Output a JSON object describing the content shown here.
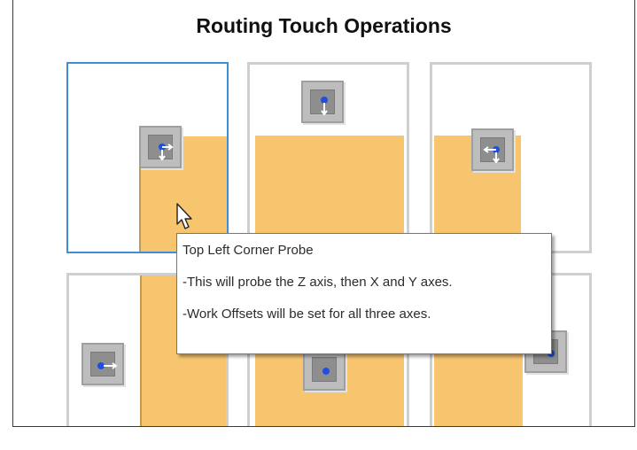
{
  "title": "Routing Touch Operations",
  "colors": {
    "stock": "#f6c56e",
    "selection_border": "#3f8fd8",
    "probe_dot": "#1f4fe0"
  },
  "operations": [
    {
      "icon": "top-left-corner-probe-icon",
      "selected": true
    },
    {
      "icon": "top-center-probe-icon",
      "selected": false
    },
    {
      "icon": "top-right-corner-probe-icon",
      "selected": false
    },
    {
      "icon": "left-edge-probe-icon",
      "selected": false
    },
    {
      "icon": "center-probe-icon",
      "selected": false
    },
    {
      "icon": "right-edge-probe-icon",
      "selected": false
    }
  ],
  "tooltip": {
    "title": "Top Left Corner Probe",
    "line1": "-This will probe the Z axis, then X and Y axes.",
    "line2": "-Work Offsets will be set for all three axes."
  }
}
